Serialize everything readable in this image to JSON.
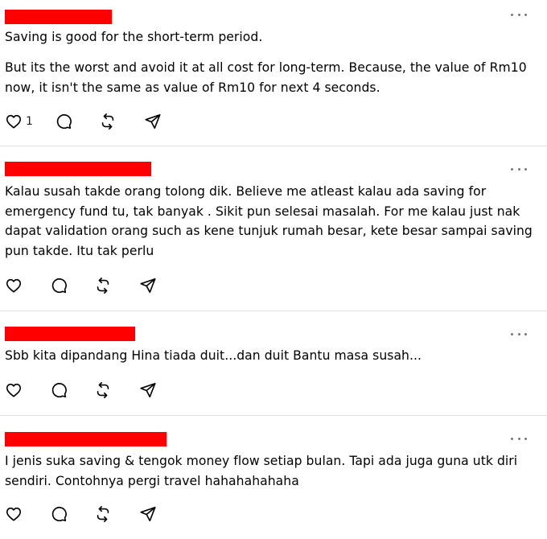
{
  "posts": [
    {
      "paragraphs": [
        "Saving is good for the short-term period.",
        "But its the worst and avoid it at all cost for long-term. Because, the value of Rm10 now, it isn't the same as value of Rm10 for next 4 seconds."
      ],
      "like_count": "1"
    },
    {
      "paragraphs": [
        "Kalau susah takde orang tolong dik. Believe me atleast kalau ada saving for emergency fund tu, tak banyak . Sikit pun selesai masalah. For me kalau just nak dapat validation orang such as kene tunjuk rumah besar, kete besar sampai saving pun takde. Itu tak perlu"
      ]
    },
    {
      "paragraphs": [
        "Sbb kita dipandang Hina tiada duit...dan duit Bantu masa susah..."
      ]
    },
    {
      "paragraphs": [
        "I jenis suka saving & tengok money flow setiap bulan. Tapi ada juga guna utk diri sendiri. Contohnya pergi travel hahahahahaha"
      ]
    }
  ],
  "icons": {
    "like": "heart-icon",
    "comment": "comment-icon",
    "repost": "repost-icon",
    "share": "send-icon",
    "more": "more-options-icon"
  },
  "colors": {
    "redaction": "#ff0000",
    "divider": "#e0e0e0",
    "icon": "#000000"
  }
}
